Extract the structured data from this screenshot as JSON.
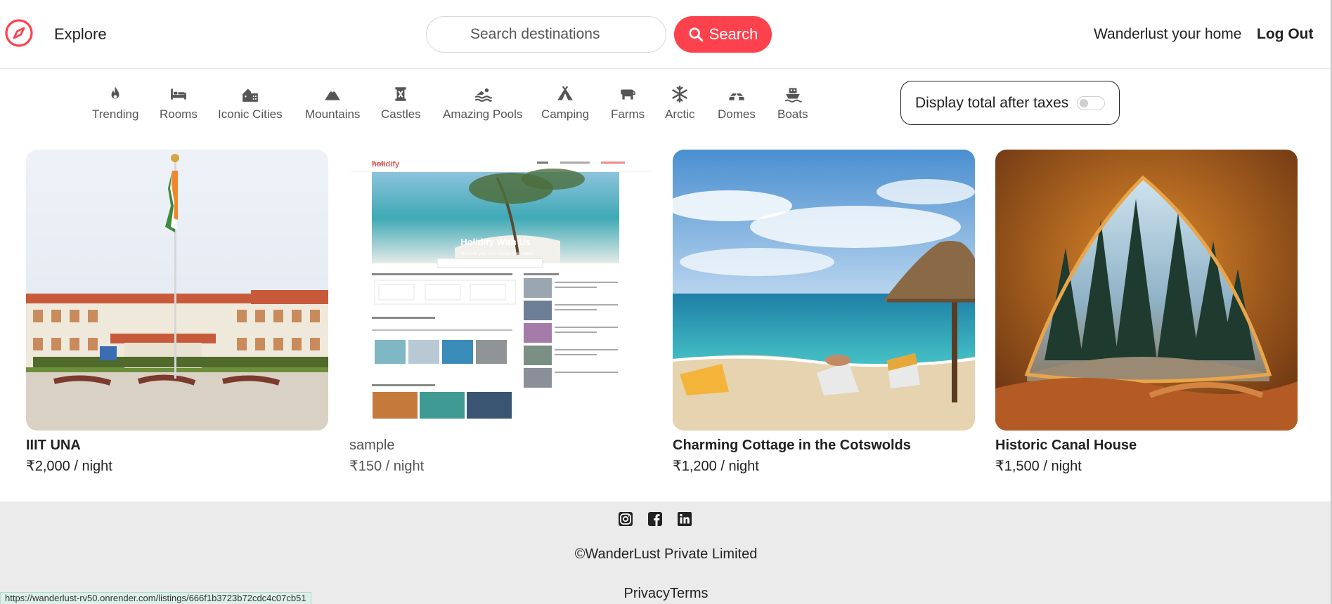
{
  "navbar": {
    "logo_icon": "compass-icon",
    "explore_label": "Explore",
    "search_placeholder": "Search destinations",
    "search_button_label": "Search",
    "home_label": "Wanderlust your home",
    "logout_label": "Log Out",
    "accent_color": "#fe424d"
  },
  "filters": [
    {
      "label": "Trending",
      "icon": "fire-icon"
    },
    {
      "label": "Rooms",
      "icon": "bed-icon"
    },
    {
      "label": "Iconic Cities",
      "icon": "city-icon"
    },
    {
      "label": "Mountains",
      "icon": "mountain-icon"
    },
    {
      "label": "Castles",
      "icon": "castle-icon"
    },
    {
      "label": "Amazing Pools",
      "icon": "swimmer-icon"
    },
    {
      "label": "Camping",
      "icon": "tent-icon"
    },
    {
      "label": "Farms",
      "icon": "cow-icon"
    },
    {
      "label": "Arctic",
      "icon": "snowflake-icon"
    },
    {
      "label": "Domes",
      "icon": "igloo-icon"
    },
    {
      "label": "Boats",
      "icon": "ship-icon"
    }
  ],
  "tax_toggle": {
    "label": "Display total after taxes",
    "on": false
  },
  "listings": [
    {
      "title": "IIIT UNA",
      "price": "₹2,000 / night",
      "image": "campus-building-with-flag"
    },
    {
      "title": "sample",
      "price": "₹150 / night",
      "image": "website-screenshot",
      "muted": true,
      "screenshot": {
        "brand": "holidify",
        "hero_title": "Holidify With Us",
        "hero_subtitle": "Discover your next Holiday destination"
      }
    },
    {
      "title": "Charming Cottage in the Cotswolds",
      "price": "₹1,200 / night",
      "image": "beach-with-umbrella"
    },
    {
      "title": "Historic Canal House",
      "price": "₹1,500 / night",
      "image": "tent-forest-view"
    }
  ],
  "footer": {
    "social_icons": [
      "instagram-icon",
      "facebook-icon",
      "linkedin-icon"
    ],
    "copyright": "©WanderLust Private Limited",
    "privacy_terms": "PrivacyTerms"
  },
  "status_bar": {
    "url": "https://wanderlust-rv50.onrender.com/listings/666f1b3723b72cdc4c07cb51"
  }
}
